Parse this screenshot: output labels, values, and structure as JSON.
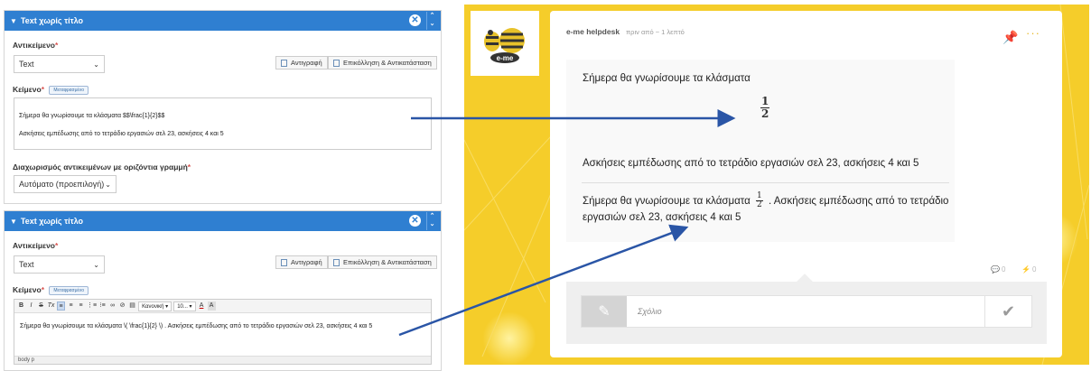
{
  "editor_panels": [
    {
      "title": "Text χωρίς τίτλο",
      "object_label": "Αντικείμενο",
      "object_value": "Text",
      "copy_label": "Αντιγραφή",
      "paste_label": "Επικόλληση & Αντικατάσταση",
      "text_label": "Κείμενο",
      "translated_badge": "Μεταφρασμένο",
      "content_lines": [
        "Σήμερα θα γνωρίσουμε τα κλάσματα  $$\\frac{1}{2}$$",
        "Ασκήσεις εμπέδωσης από το τετράδιο εργασιών σελ 23, ασκήσεις 4 και 5"
      ],
      "separator_label": "Διαχωρισμός αντικειμένων με οριζόντια γραμμή",
      "separator_value": "Αυτόματο (προεπιλογή)"
    },
    {
      "title": "Text χωρίς τίτλο",
      "object_label": "Αντικείμενο",
      "object_value": "Text",
      "copy_label": "Αντιγραφή",
      "paste_label": "Επικόλληση & Αντικατάσταση",
      "text_label": "Κείμενο",
      "translated_badge": "Μεταφρασμένο",
      "toolbar": {
        "bold": "B",
        "italic": "I",
        "strike": "S",
        "clear": "Tx",
        "format": "Κανονική",
        "size": "10...",
        "textcolor": "A",
        "bgcolor": "A"
      },
      "content": "Σήμερα θα γνωρίσουμε τα κλάσματα  \\( \\frac{1}{2} \\) . Ασκήσεις εμπέδωσης από το τετράδιο εργασιών σελ 23, ασκήσεις 4 και 5",
      "status": "body   p"
    }
  ],
  "post": {
    "author": "e-me helpdesk",
    "time": "πριν από ~ 1 λεπτό",
    "logo_text": "e-me",
    "line1": "Σήμερα θα γνωρίσουμε τα κλάσματα",
    "fraction": {
      "num": "1",
      "den": "2"
    },
    "line2": "Ασκήσεις εμπέδωσης από το τετράδιο εργασιών σελ 23, ασκήσεις 4 και 5",
    "combined_part1": "Σήμερα θα γνωρίσουμε τα κλάσματα",
    "combined_part2": ". Ασκήσεις εμπέδωσης από το τετράδιο",
    "combined_line2": "εργασιών σελ 23, ασκήσεις 4 και 5",
    "comments_count": "0",
    "likes_count": "0",
    "comment_placeholder": "Σχόλιο"
  },
  "colors": {
    "header_blue": "#2f7fd1",
    "background_yellow": "#f5cd2a",
    "arrow_blue": "#2a55a6"
  }
}
